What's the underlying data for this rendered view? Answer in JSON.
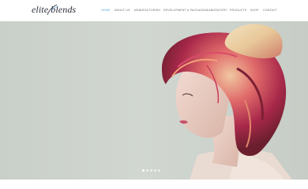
{
  "brand": {
    "logo_text": "elite blends",
    "logo_icon": "swirl-leaf-icon"
  },
  "nav": {
    "items": [
      {
        "label": "HOME",
        "active": true
      },
      {
        "label": "ABOUT US",
        "active": false
      },
      {
        "label": "MANUFACTURING",
        "active": false
      },
      {
        "label": "DEVELOPMENT & PACKAGING",
        "active": false
      },
      {
        "label": "LABORATORY",
        "active": false
      },
      {
        "label": "PRODUCTS",
        "active": false
      },
      {
        "label": "SHOP",
        "active": false
      },
      {
        "label": "CONTACT",
        "active": false
      }
    ]
  },
  "hero": {
    "image": "woman-with-red-updo-hair",
    "slides_count": 5,
    "active_slide": 1
  },
  "colors": {
    "accent": "#4ea7d9",
    "nav_text": "#6d6f73",
    "logo": "#2a2d3a",
    "hero_bg": "#cfd4ce"
  }
}
